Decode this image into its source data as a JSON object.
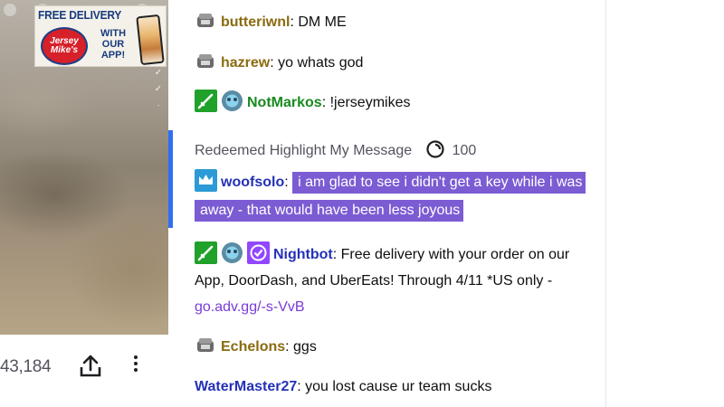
{
  "player": {
    "viewer_count": "43,184",
    "ad": {
      "headline": "FREE DELIVERY",
      "logo_text": "Jersey Mike's",
      "tagline": "WITH OUR APP!"
    }
  },
  "chat": {
    "messages": [
      {
        "username": "butteriwnl",
        "text": "DM ME"
      },
      {
        "username": "hazrew",
        "text": "yo whats god"
      },
      {
        "username": "NotMarkos",
        "text": "!jerseymikes"
      },
      {
        "username": "Echelons",
        "text": "ggs"
      },
      {
        "username": "WaterMaster27",
        "text": "you lost cause ur team sucks"
      }
    ],
    "highlight": {
      "label": "Redeemed Highlight My Message",
      "cost": "100",
      "username": "woofsolo",
      "text": "i am glad to see i didn't get a key while i was away - that would have been less joyous"
    },
    "bot": {
      "username": "Nightbot",
      "text": "Free delivery with your order on our App, DoorDash, and UberEats! Through 4/11 *US only - ",
      "link": "go.adv.gg/-s-VvB"
    },
    "colors": {
      "highlight_bg": "#7b5cd3",
      "redeem_accent": "#2f6ff2",
      "link": "#7a3cd6"
    }
  }
}
